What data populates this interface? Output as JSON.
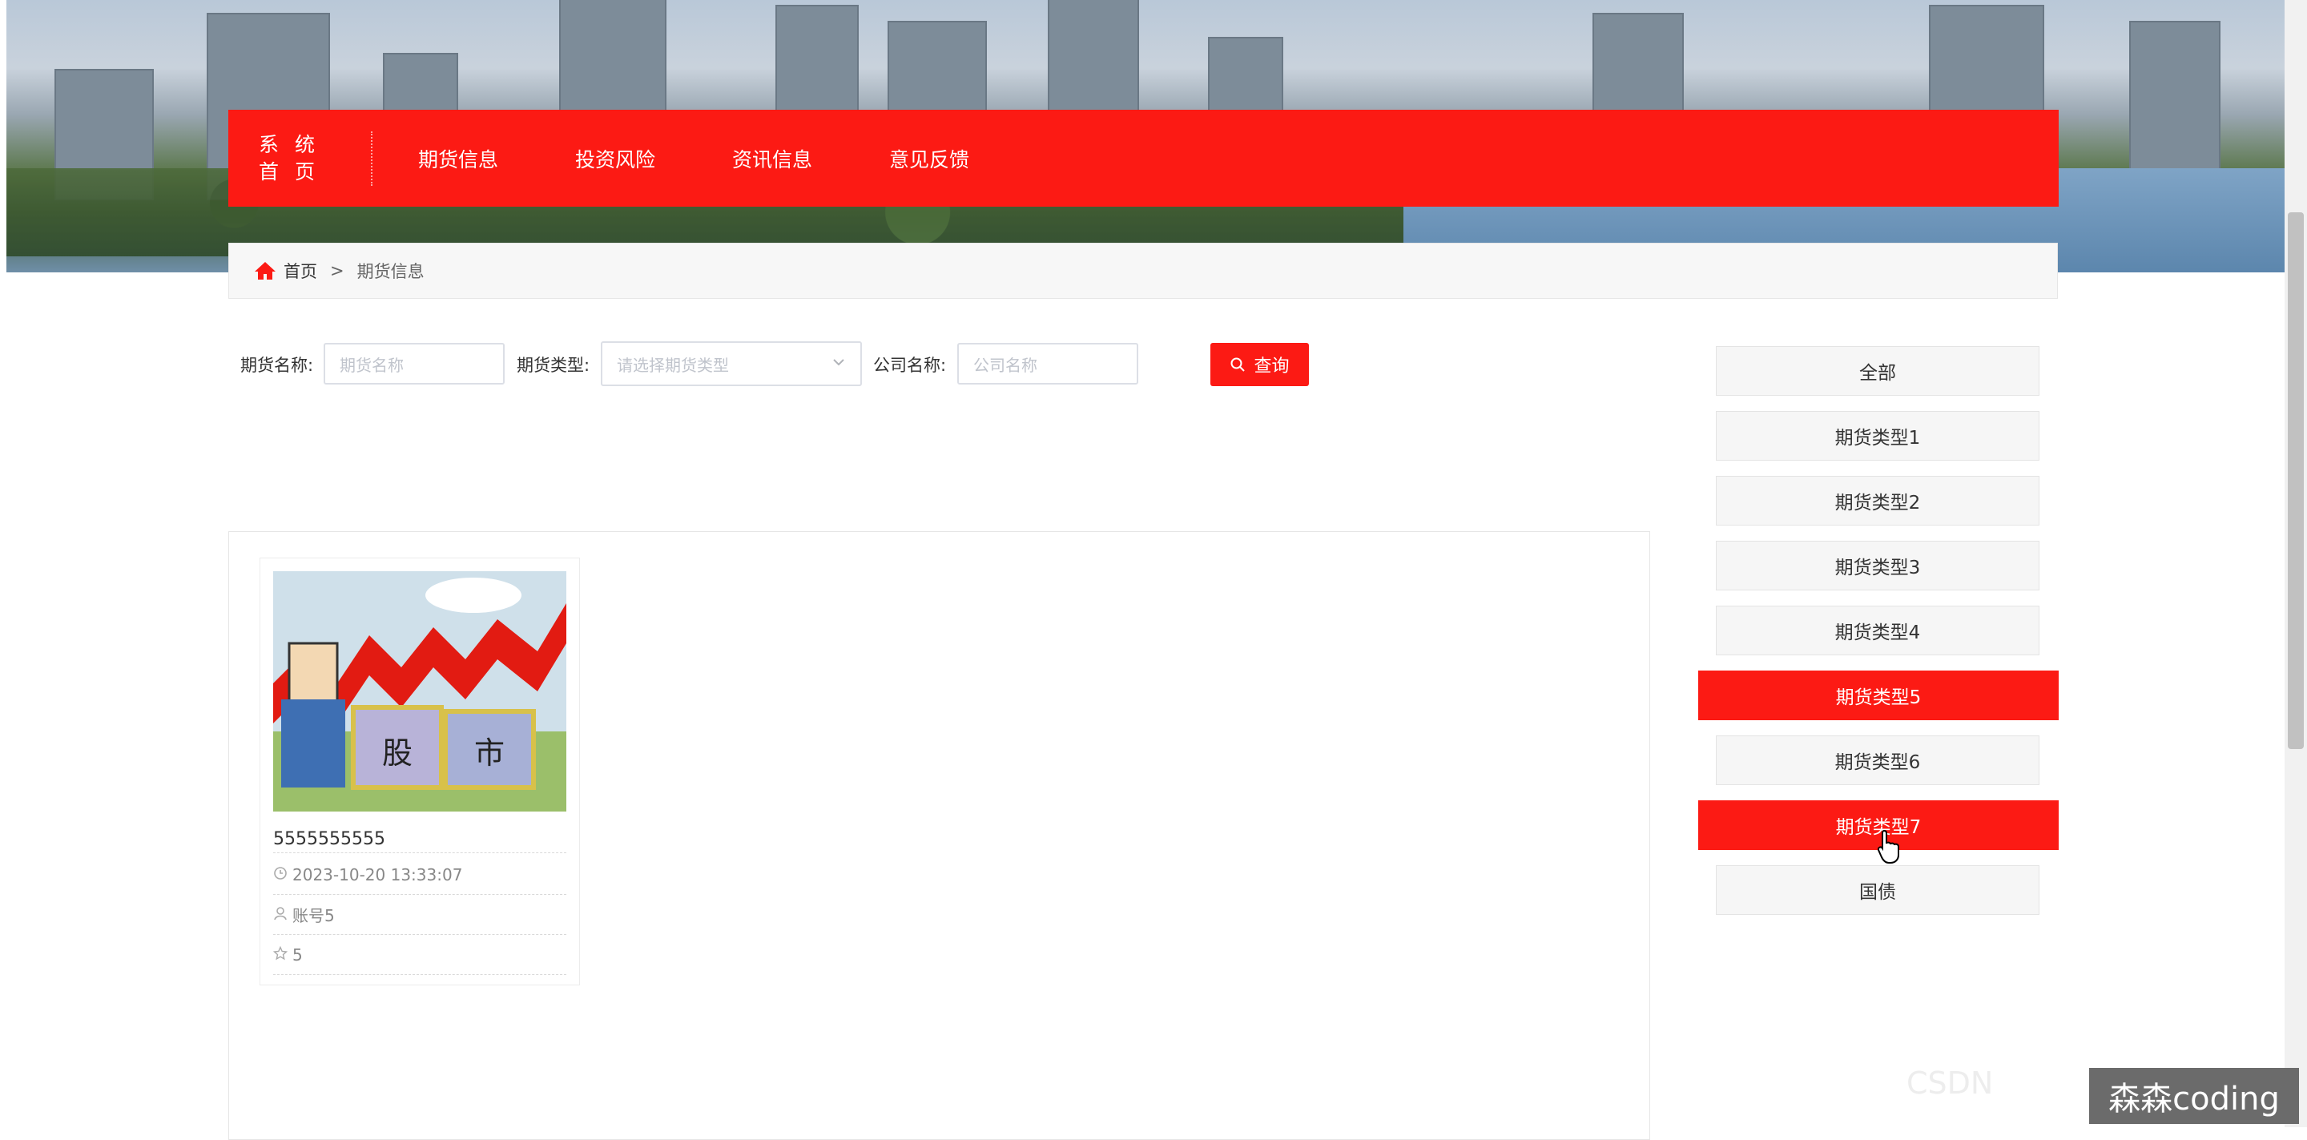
{
  "nav": {
    "home_line1": "系 统",
    "home_line2": "首 页",
    "items": [
      "期货信息",
      "投资风险",
      "资讯信息",
      "意见反馈"
    ]
  },
  "breadcrumb": {
    "home": "首页",
    "separator": ">",
    "current": "期货信息"
  },
  "search": {
    "name_label": "期货名称:",
    "name_placeholder": "期货名称",
    "type_label": "期货类型:",
    "type_placeholder": "请选择期货类型",
    "company_label": "公司名称:",
    "company_placeholder": "公司名称",
    "button_label": "查询"
  },
  "card": {
    "image_text_left": "股",
    "image_text_right": "市",
    "title": "5555555555",
    "time": "2023-10-20 13:33:07",
    "account": "账号5",
    "stars": "5"
  },
  "categories": [
    {
      "label": "全部",
      "active": false
    },
    {
      "label": "期货类型1",
      "active": false
    },
    {
      "label": "期货类型2",
      "active": false
    },
    {
      "label": "期货类型3",
      "active": false
    },
    {
      "label": "期货类型4",
      "active": false
    },
    {
      "label": "期货类型5",
      "active": true
    },
    {
      "label": "期货类型6",
      "active": false
    },
    {
      "label": "期货类型7",
      "active": true
    },
    {
      "label": "国债",
      "active": false
    }
  ],
  "watermark": "森森coding",
  "colors": {
    "accent": "#fc1a14"
  }
}
